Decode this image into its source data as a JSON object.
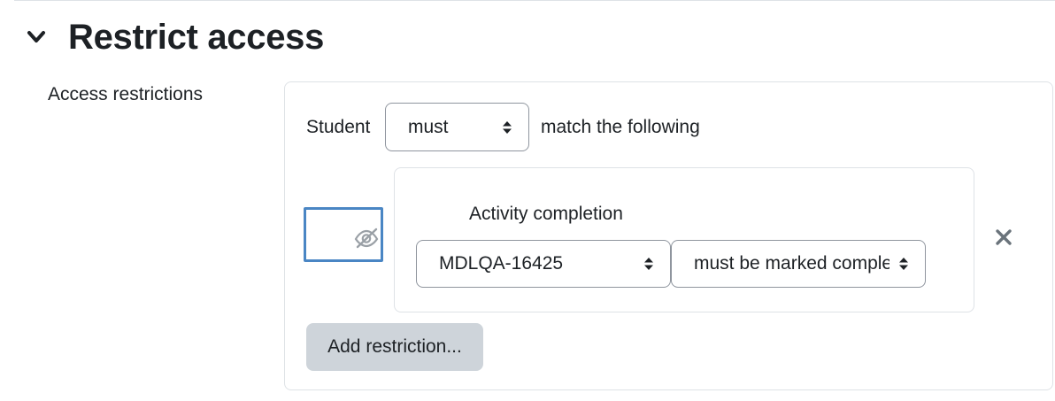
{
  "section": {
    "title": "Restrict access",
    "collapse_icon": "chevron-down-icon"
  },
  "field": {
    "label": "Access restrictions"
  },
  "restrictions": {
    "student_label": "Student",
    "must_select": {
      "selected": "must",
      "options": [
        "must"
      ]
    },
    "match_label": "match the following",
    "eye_icon": "eye-slash-icon",
    "condition": {
      "title": "Activity completion",
      "activity_select": {
        "selected": "MDLQA-16425"
      },
      "completion_select": {
        "selected": "must be marked complete"
      },
      "delete_icon": "close-icon"
    },
    "add_restriction_label": "Add restriction..."
  },
  "colors": {
    "text": "#1d2125",
    "border": "#dee2e6",
    "select_border": "#8f959e",
    "focus_border": "#4a86c4",
    "button_bg": "#ced4da",
    "icon_gray": "#6a737b"
  }
}
